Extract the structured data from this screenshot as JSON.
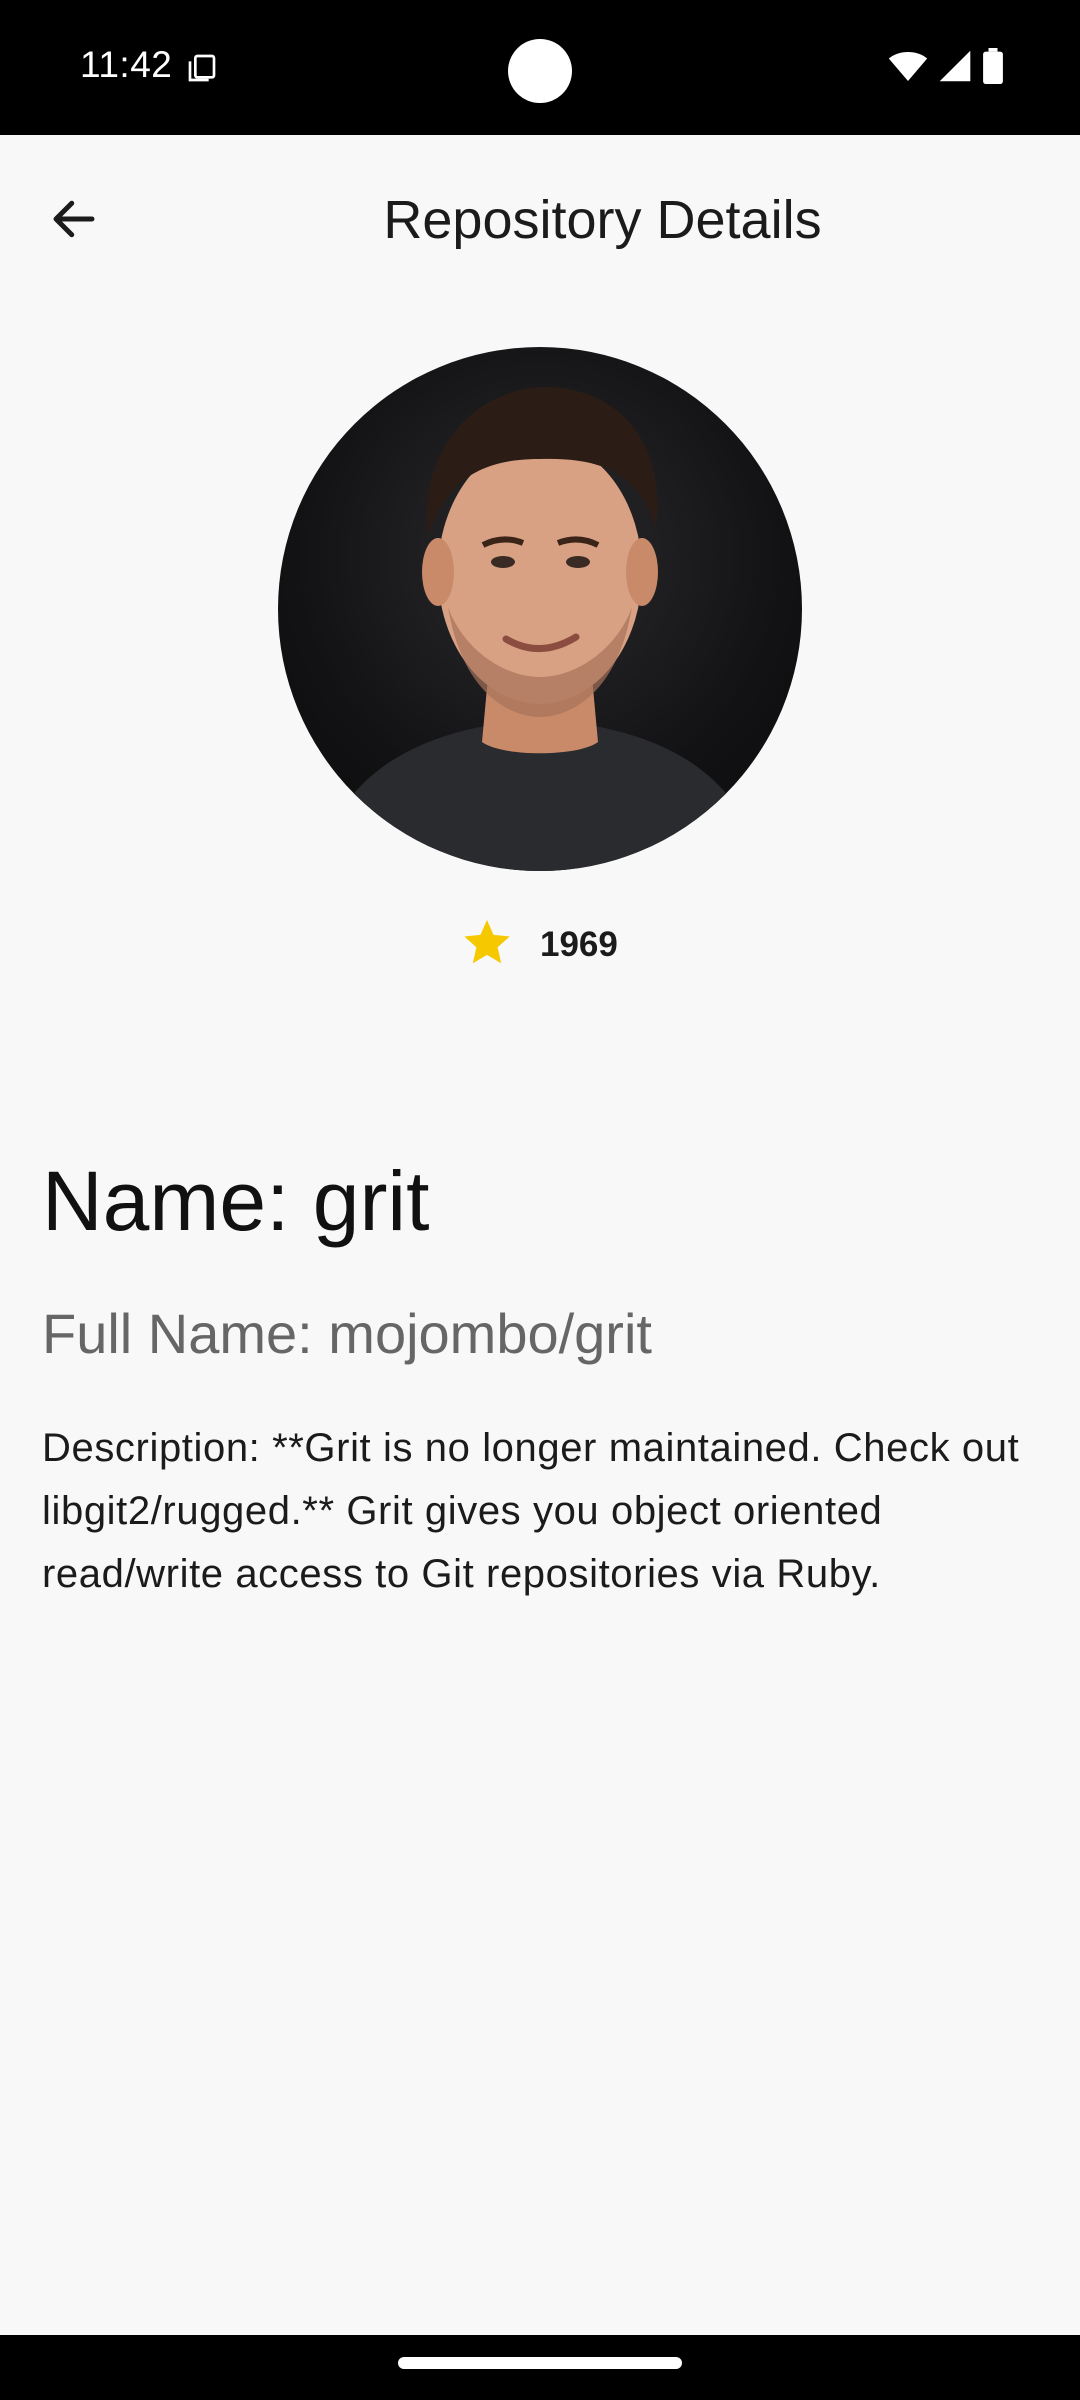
{
  "status_bar": {
    "time": "11:42",
    "icons": [
      "copy-icon",
      "wifi-icon",
      "signal-icon",
      "battery-icon"
    ]
  },
  "top_bar": {
    "title": "Repository Details",
    "back_icon": "arrow-back-icon"
  },
  "repo": {
    "avatar_icon": "avatar-photo",
    "star_icon": "star-icon",
    "stars": "1969",
    "name_line": "Name: grit",
    "full_name_line": "Full Name: mojombo/grit",
    "description_line": "Description: **Grit is no longer maintained. Check out libgit2/rugged.** Grit gives you object oriented read/write access to Git repositories via Ruby."
  },
  "colors": {
    "background": "#f8f8f8",
    "star": "#f5c800",
    "secondary_text": "#666666"
  }
}
